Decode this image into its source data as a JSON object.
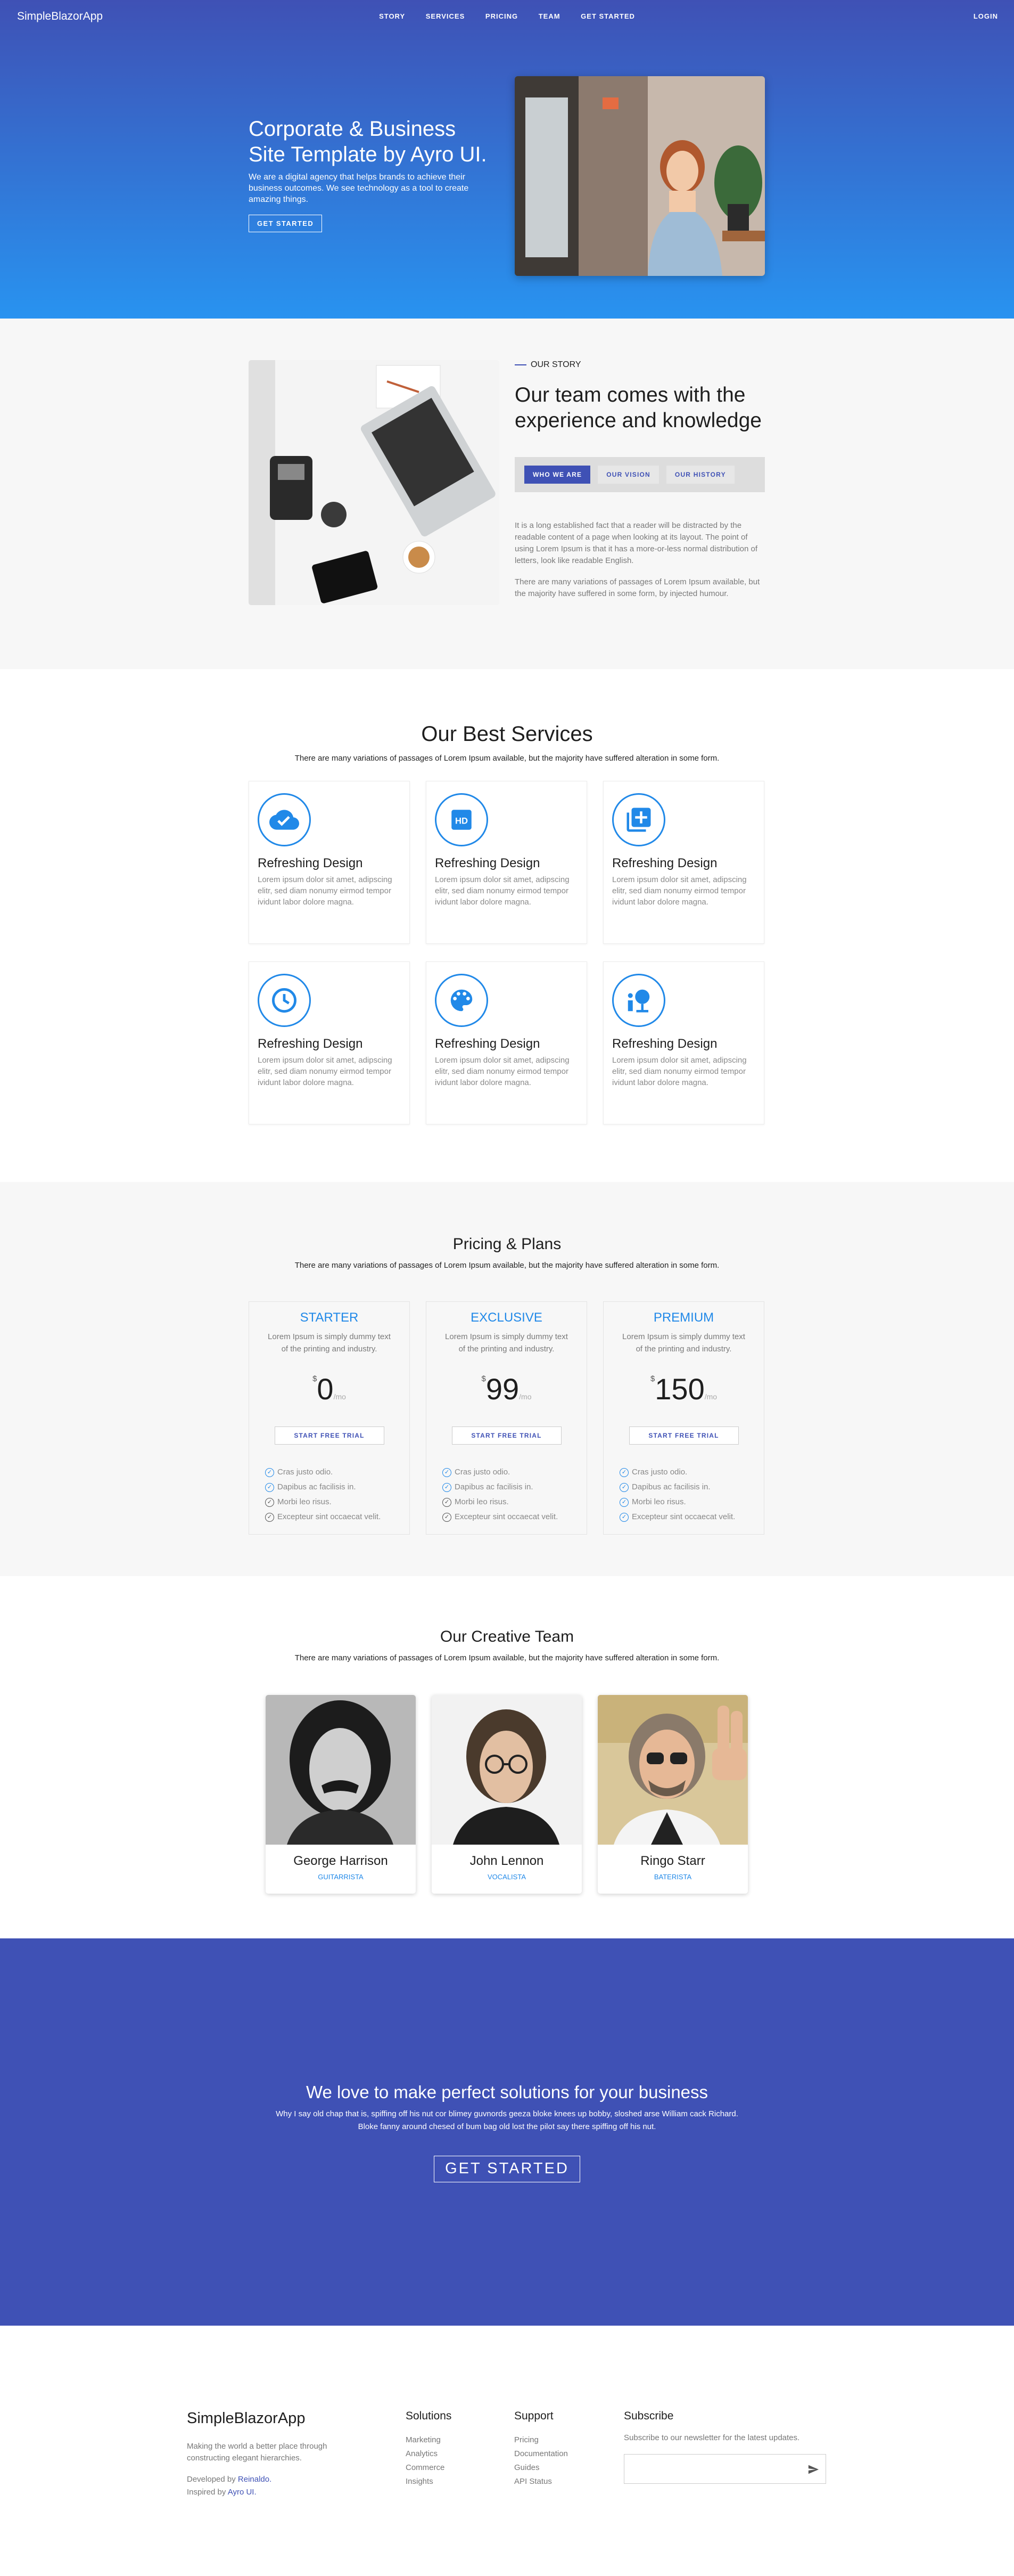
{
  "nav": {
    "brand": "SimpleBlazorApp",
    "links": [
      "STORY",
      "SERVICES",
      "PRICING",
      "TEAM",
      "GET STARTED"
    ],
    "login": "LOGIN"
  },
  "hero": {
    "title": "Corporate & Business Site Template by Ayro UI.",
    "subtitle": "We are a digital agency that helps brands to achieve their business outcomes. We see technology as a tool to create amazing things.",
    "cta": "GET STARTED"
  },
  "story": {
    "eyebrow": "OUR STORY",
    "heading": "Our team comes with the experience and knowledge",
    "tabs": [
      "WHO WE ARE",
      "OUR VISION",
      "OUR HISTORY"
    ],
    "para1": "It is a long established fact that a reader will be distracted by the readable content of a page when looking at its layout. The point of using Lorem Ipsum is that it has a more-or-less normal distribution of letters, look like readable English.",
    "para2": "There are many variations of passages of Lorem Ipsum available, but the majority have suffered in some form, by injected humour."
  },
  "services": {
    "title": "Our Best Services",
    "subtitle": "There are many variations of passages of Lorem Ipsum available, but the majority have suffered alteration in some form.",
    "cards": [
      {
        "icon": "cloud-check-icon",
        "title": "Refreshing Design",
        "text": "Lorem ipsum dolor sit amet, adipscing elitr, sed diam nonumy eirmod tempor ividunt labor dolore magna."
      },
      {
        "icon": "hd-icon",
        "title": "Refreshing Design",
        "text": "Lorem ipsum dolor sit amet, adipscing elitr, sed diam nonumy eirmod tempor ividunt labor dolore magna."
      },
      {
        "icon": "library-add-icon",
        "title": "Refreshing Design",
        "text": "Lorem ipsum dolor sit amet, adipscing elitr, sed diam nonumy eirmod tempor ividunt labor dolore magna."
      },
      {
        "icon": "clock-icon",
        "title": "Refreshing Design",
        "text": "Lorem ipsum dolor sit amet, adipscing elitr, sed diam nonumy eirmod tempor ividunt labor dolore magna."
      },
      {
        "icon": "palette-icon",
        "title": "Refreshing Design",
        "text": "Lorem ipsum dolor sit amet, adipscing elitr, sed diam nonumy eirmod tempor ividunt labor dolore magna."
      },
      {
        "icon": "category-icon",
        "title": "Refreshing Design",
        "text": "Lorem ipsum dolor sit amet, adipscing elitr, sed diam nonumy eirmod tempor ividunt labor dolore magna."
      }
    ]
  },
  "pricing": {
    "title": "Pricing & Plans",
    "subtitle": "There are many variations of passages of Lorem Ipsum available, but the majority have suffered alteration in some form.",
    "plans": [
      {
        "name": "STARTER",
        "desc": "Lorem Ipsum is simply dummy text of the printing and industry.",
        "currency": "$",
        "price": "0",
        "period": "/mo",
        "cta": "START FREE TRIAL"
      },
      {
        "name": "EXCLUSIVE",
        "desc": "Lorem Ipsum is simply dummy text of the printing and industry.",
        "currency": "$",
        "price": "99",
        "period": "/mo",
        "cta": "START FREE TRIAL"
      },
      {
        "name": "PREMIUM",
        "desc": "Lorem Ipsum is simply dummy text of the printing and industry.",
        "currency": "$",
        "price": "150",
        "period": "/mo",
        "cta": "START FREE TRIAL"
      }
    ],
    "features": [
      "Cras justo odio.",
      "Dapibus ac facilisis in.",
      "Morbi leo risus.",
      "Excepteur sint occaecat velit."
    ]
  },
  "team": {
    "title": "Our Creative Team",
    "subtitle": "There are many variations of passages of Lorem Ipsum available, but the majority have suffered alteration in some form.",
    "members": [
      {
        "name": "George Harrison",
        "role": "GUITARRISTA"
      },
      {
        "name": "John Lennon",
        "role": "VOCALISTA"
      },
      {
        "name": "Ringo Starr",
        "role": "BATERISTA"
      }
    ]
  },
  "cta": {
    "title": "We love to make perfect solutions for your business",
    "text": "Why I say old chap that is, spiffing off his nut cor blimey guvnords geeza bloke knees up bobby, sloshed arse William cack Richard. Bloke fanny around chesed of bum bag old lost the pilot say there spiffing off his nut.",
    "button": "GET STARTED"
  },
  "footer": {
    "brand": "SimpleBlazorApp",
    "tagline": "Making the world a better place through constructing elegant hierarchies.",
    "developed_label": "Developed by",
    "developed_name": "Reinaldo.",
    "inspired_label": "Inspired by",
    "inspired_name": "Ayro UI.",
    "solutions_title": "Solutions",
    "solutions": [
      "Marketing",
      "Analytics",
      "Commerce",
      "Insights"
    ],
    "support_title": "Support",
    "support": [
      "Pricing",
      "Documentation",
      "Guides",
      "API Status"
    ],
    "subscribe_title": "Subscribe",
    "subscribe_text": "Subscribe to our newsletter for the latest updates.",
    "email_placeholder": ""
  }
}
